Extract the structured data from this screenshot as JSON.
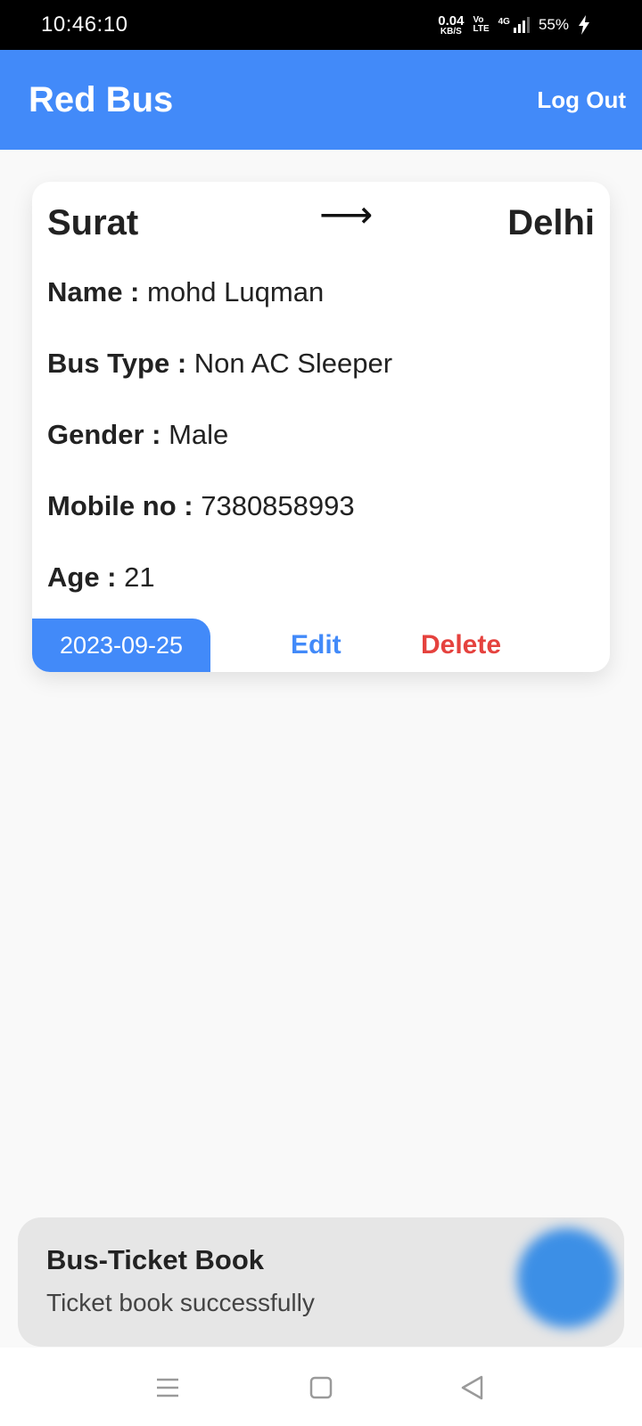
{
  "status_bar": {
    "time": "10:46:10",
    "net_speed_value": "0.04",
    "net_speed_unit": "KB/S",
    "volte_top": "Vo",
    "volte_bottom": "LTE",
    "network": "4G",
    "battery": "55%"
  },
  "app_bar": {
    "title": "Red Bus",
    "logout_label": "Log Out"
  },
  "ticket": {
    "from": "Surat",
    "to": "Delhi",
    "name_label": "Name :",
    "name_value": "mohd Luqman",
    "bus_type_label": "Bus Type :",
    "bus_type_value": "Non AC Sleeper",
    "gender_label": "Gender :",
    "gender_value": "Male",
    "mobile_label": "Mobile no :",
    "mobile_value": "7380858993",
    "age_label": "Age :",
    "age_value": "21",
    "date": "2023-09-25",
    "edit_label": "Edit",
    "delete_label": "Delete"
  },
  "toast": {
    "title": "Bus-Ticket Book",
    "message": "Ticket book successfully"
  },
  "colors": {
    "primary": "#428af9",
    "danger": "#e5423e",
    "background": "#f9f9f9"
  },
  "icons": [
    "arrow-right-icon",
    "menu-icon",
    "home-icon",
    "back-icon",
    "bolt-icon"
  ]
}
